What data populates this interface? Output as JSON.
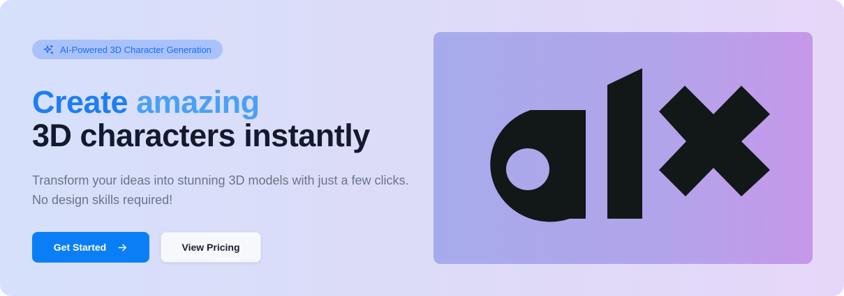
{
  "badge": {
    "label": "AI-Powered 3D Character Generation",
    "icon": "sparkles-icon"
  },
  "headline": {
    "line1_part1": "Create ",
    "line1_accent": "amazing",
    "line2": "3D characters instantly"
  },
  "subtitle": {
    "line1": "Transform your ideas into stunning 3D models with just a few clicks.",
    "line2": "No design skills required!"
  },
  "actions": {
    "primary_label": "Get Started",
    "primary_icon": "arrow-right-icon",
    "secondary_label": "View Pricing"
  },
  "logo": {
    "text": "alx",
    "color": "#121718"
  },
  "colors": {
    "primary": "#0a7ff5",
    "accent_blue": "#4aa0f5",
    "badge_bg": "#a9c2fb",
    "heading_dark": "#141a2e"
  }
}
